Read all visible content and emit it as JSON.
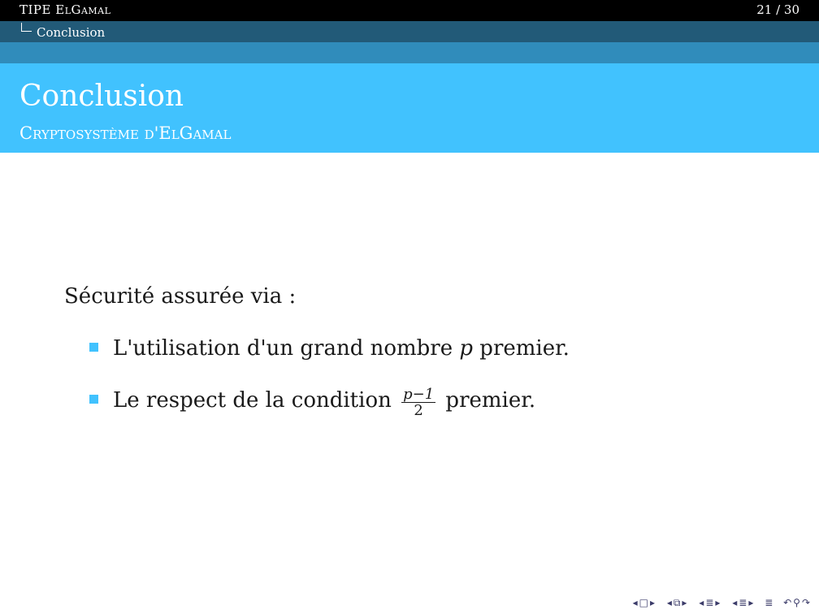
{
  "header": {
    "presentation_title": "TIPE ElGamal",
    "page_counter": "21 / 30",
    "section": "Conclusion"
  },
  "frame": {
    "title": "Conclusion",
    "subtitle": "Cryptosystème d'ElGamal"
  },
  "body": {
    "lead": "Sécurité assurée via :",
    "items": [
      {
        "before": "L'utilisation d'un grand nombre ",
        "var": "p",
        "after": " premier."
      },
      {
        "before": "Le respect de la condition ",
        "frac_num": "p−1",
        "frac_den": "2",
        "after": " premier."
      }
    ]
  },
  "navigation": {
    "icons": [
      "prev-arrow-icon",
      "frame-icon",
      "next-arrow-icon",
      "prev-arrow-icon",
      "subsection-icon",
      "next-arrow-icon",
      "prev-arrow-icon",
      "section-icon",
      "next-arrow-icon",
      "prev-arrow-icon",
      "section-icon",
      "next-arrow-icon",
      "align-icon",
      "search-icon",
      "back-icon",
      "forward-icon"
    ]
  },
  "colors": {
    "bar_top": "#000000",
    "bar_section": "#225a78",
    "bar_band": "#308cbb",
    "frametitle_bg": "#41c2fe",
    "bullet": "#41c2fe"
  }
}
